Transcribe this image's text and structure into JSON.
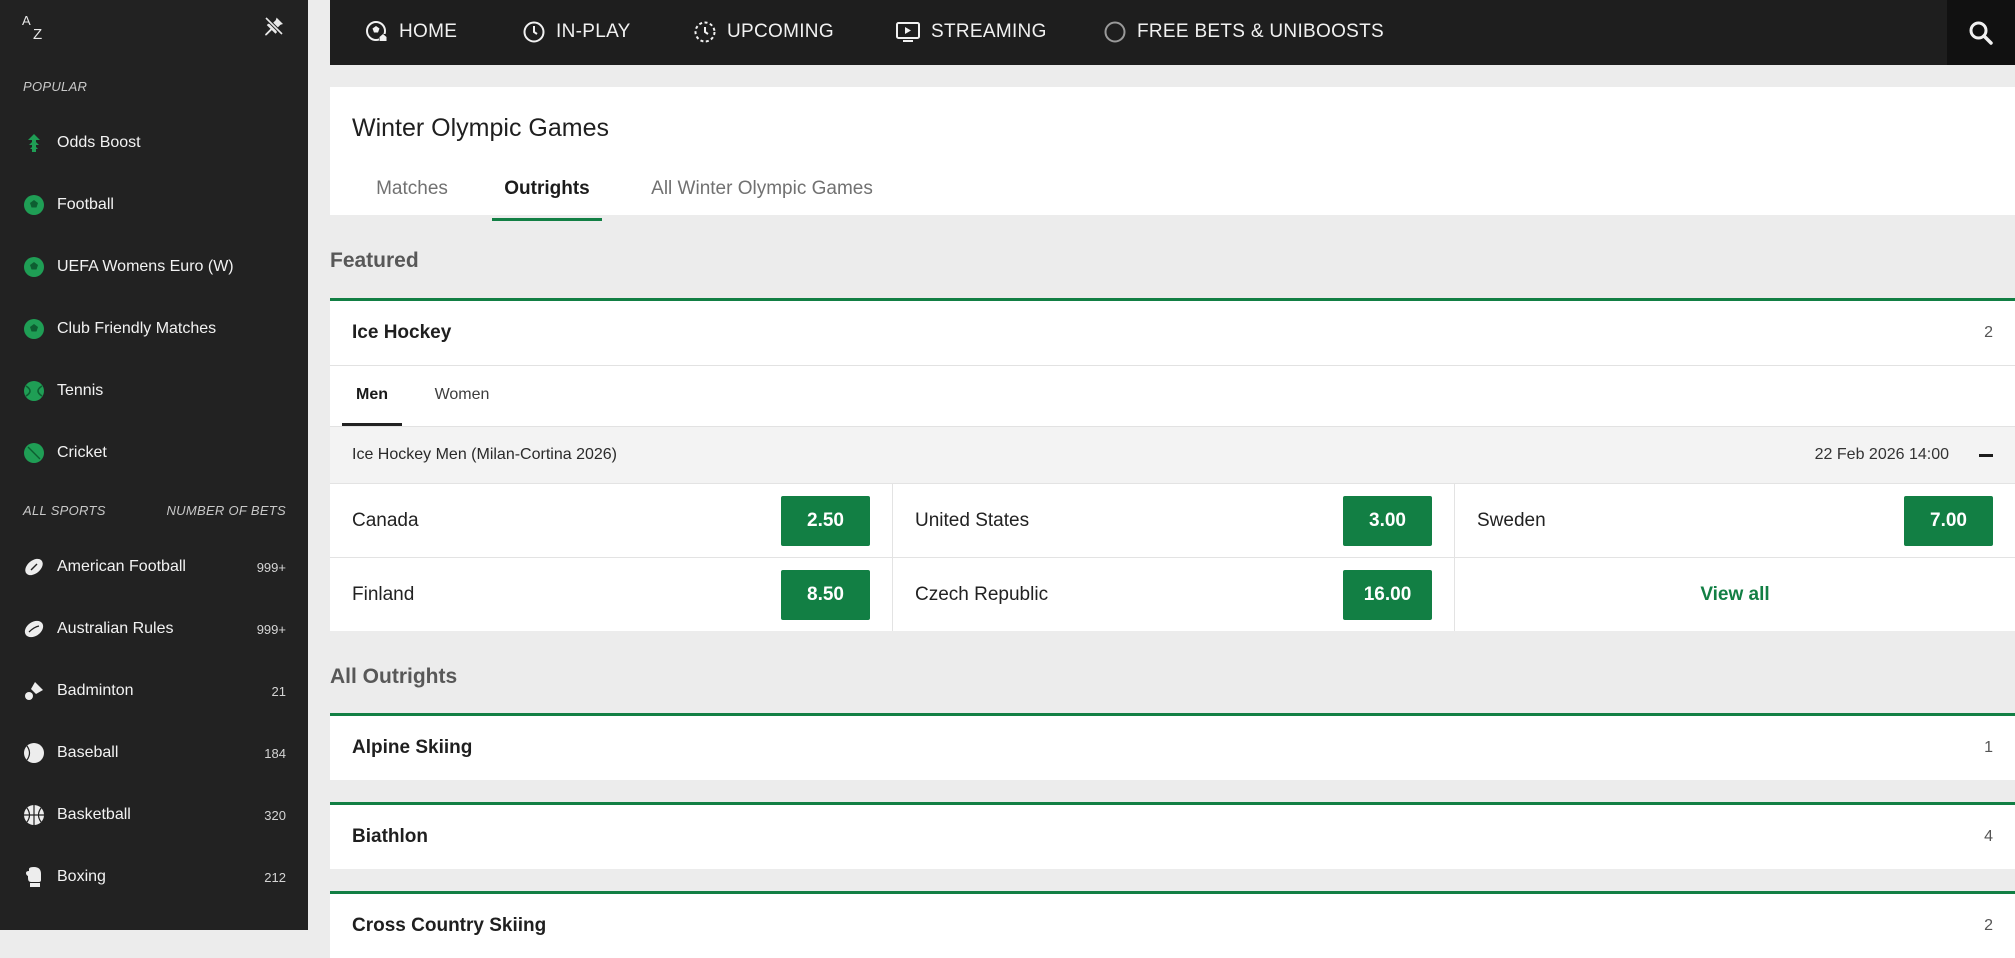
{
  "sidebar": {
    "az_label_a": "A",
    "az_label_z": "Z",
    "popular_heading": "POPULAR",
    "popular": [
      {
        "label": "Odds Boost",
        "icon": "odds-boost-icon"
      },
      {
        "label": "Football",
        "icon": "football-icon"
      },
      {
        "label": "UEFA Womens Euro (W)",
        "icon": "football-icon"
      },
      {
        "label": "Club Friendly Matches",
        "icon": "football-icon"
      },
      {
        "label": "Tennis",
        "icon": "tennis-icon"
      },
      {
        "label": "Cricket",
        "icon": "cricket-icon"
      }
    ],
    "all_sports_heading": "ALL SPORTS",
    "number_of_bets_heading": "NUMBER OF BETS",
    "sports": [
      {
        "label": "American Football",
        "count": "999+",
        "icon": "american-football-icon"
      },
      {
        "label": "Australian Rules",
        "count": "999+",
        "icon": "australian-rules-icon"
      },
      {
        "label": "Badminton",
        "count": "21",
        "icon": "badminton-icon"
      },
      {
        "label": "Baseball",
        "count": "184",
        "icon": "baseball-icon"
      },
      {
        "label": "Basketball",
        "count": "320",
        "icon": "basketball-icon"
      },
      {
        "label": "Boxing",
        "count": "212",
        "icon": "boxing-icon"
      }
    ]
  },
  "nav": {
    "home": "HOME",
    "inplay": "IN-PLAY",
    "upcoming": "UPCOMING",
    "streaming": "STREAMING",
    "free_bets": "FREE BETS & UNIBOOSTS"
  },
  "page": {
    "title": "Winter Olympic Games",
    "tabs": [
      "Matches",
      "Outrights",
      "All Winter Olympic Games"
    ],
    "active_tab": "Outrights"
  },
  "featured": {
    "heading": "Featured",
    "group": {
      "name": "Ice Hockey",
      "count": "2"
    },
    "subtabs": [
      "Men",
      "Women"
    ],
    "event": {
      "name": "Ice Hockey Men (Milan-Cortina 2026)",
      "date": "22 Feb 2026 14:00"
    },
    "odds": [
      {
        "name": "Canada",
        "price": "2.50"
      },
      {
        "name": "United States",
        "price": "3.00"
      },
      {
        "name": "Sweden",
        "price": "7.00"
      },
      {
        "name": "Finland",
        "price": "8.50"
      },
      {
        "name": "Czech Republic",
        "price": "16.00"
      }
    ],
    "view_all": "View all"
  },
  "all_outrights": {
    "heading": "All Outrights",
    "items": [
      {
        "name": "Alpine Skiing",
        "count": "1"
      },
      {
        "name": "Biathlon",
        "count": "4"
      },
      {
        "name": "Cross Country Skiing",
        "count": "2"
      }
    ]
  },
  "colors": {
    "accent": "#127f44",
    "nav_bg": "#1e1e1e",
    "sidebar_bg": "#222222"
  }
}
